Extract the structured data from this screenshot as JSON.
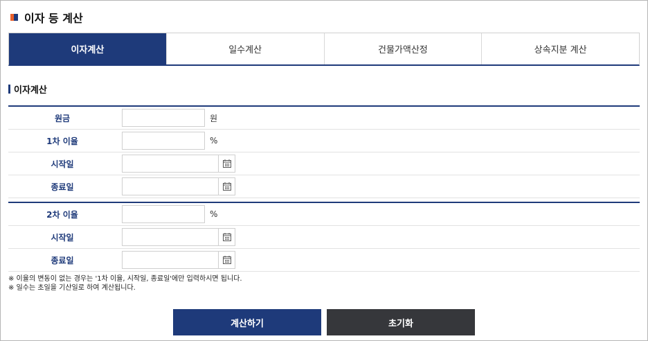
{
  "header": {
    "title": "이자 등 계산"
  },
  "tabs": [
    {
      "label": "이자계산",
      "active": true
    },
    {
      "label": "일수계산",
      "active": false
    },
    {
      "label": "건물가액산정",
      "active": false
    },
    {
      "label": "상속지분 계산",
      "active": false
    }
  ],
  "section": {
    "title": "이자계산"
  },
  "form1": {
    "principal": {
      "label": "원금",
      "value": "",
      "unit": "원"
    },
    "rate1": {
      "label": "1차 이율",
      "value": "",
      "unit": "%"
    },
    "start1": {
      "label": "시작일",
      "value": ""
    },
    "end1": {
      "label": "종료일",
      "value": ""
    }
  },
  "form2": {
    "rate2": {
      "label": "2차 이율",
      "value": "",
      "unit": "%"
    },
    "start2": {
      "label": "시작일",
      "value": ""
    },
    "end2": {
      "label": "종료일",
      "value": ""
    }
  },
  "notes": [
    "※ 이율의 변동이 없는 경우는 '1차 이율, 시작일, 종료일'에만 입력하시면 됩니다.",
    "※ 일수는 초일을 기산일로 하여 계산됩니다."
  ],
  "buttons": {
    "calculate": "계산하기",
    "reset": "초기화"
  },
  "colors": {
    "brand": "#1e3a7a",
    "accent": "#e8602c",
    "dark_button": "#36373b"
  },
  "icons": {
    "calendar": "calendar-icon"
  }
}
